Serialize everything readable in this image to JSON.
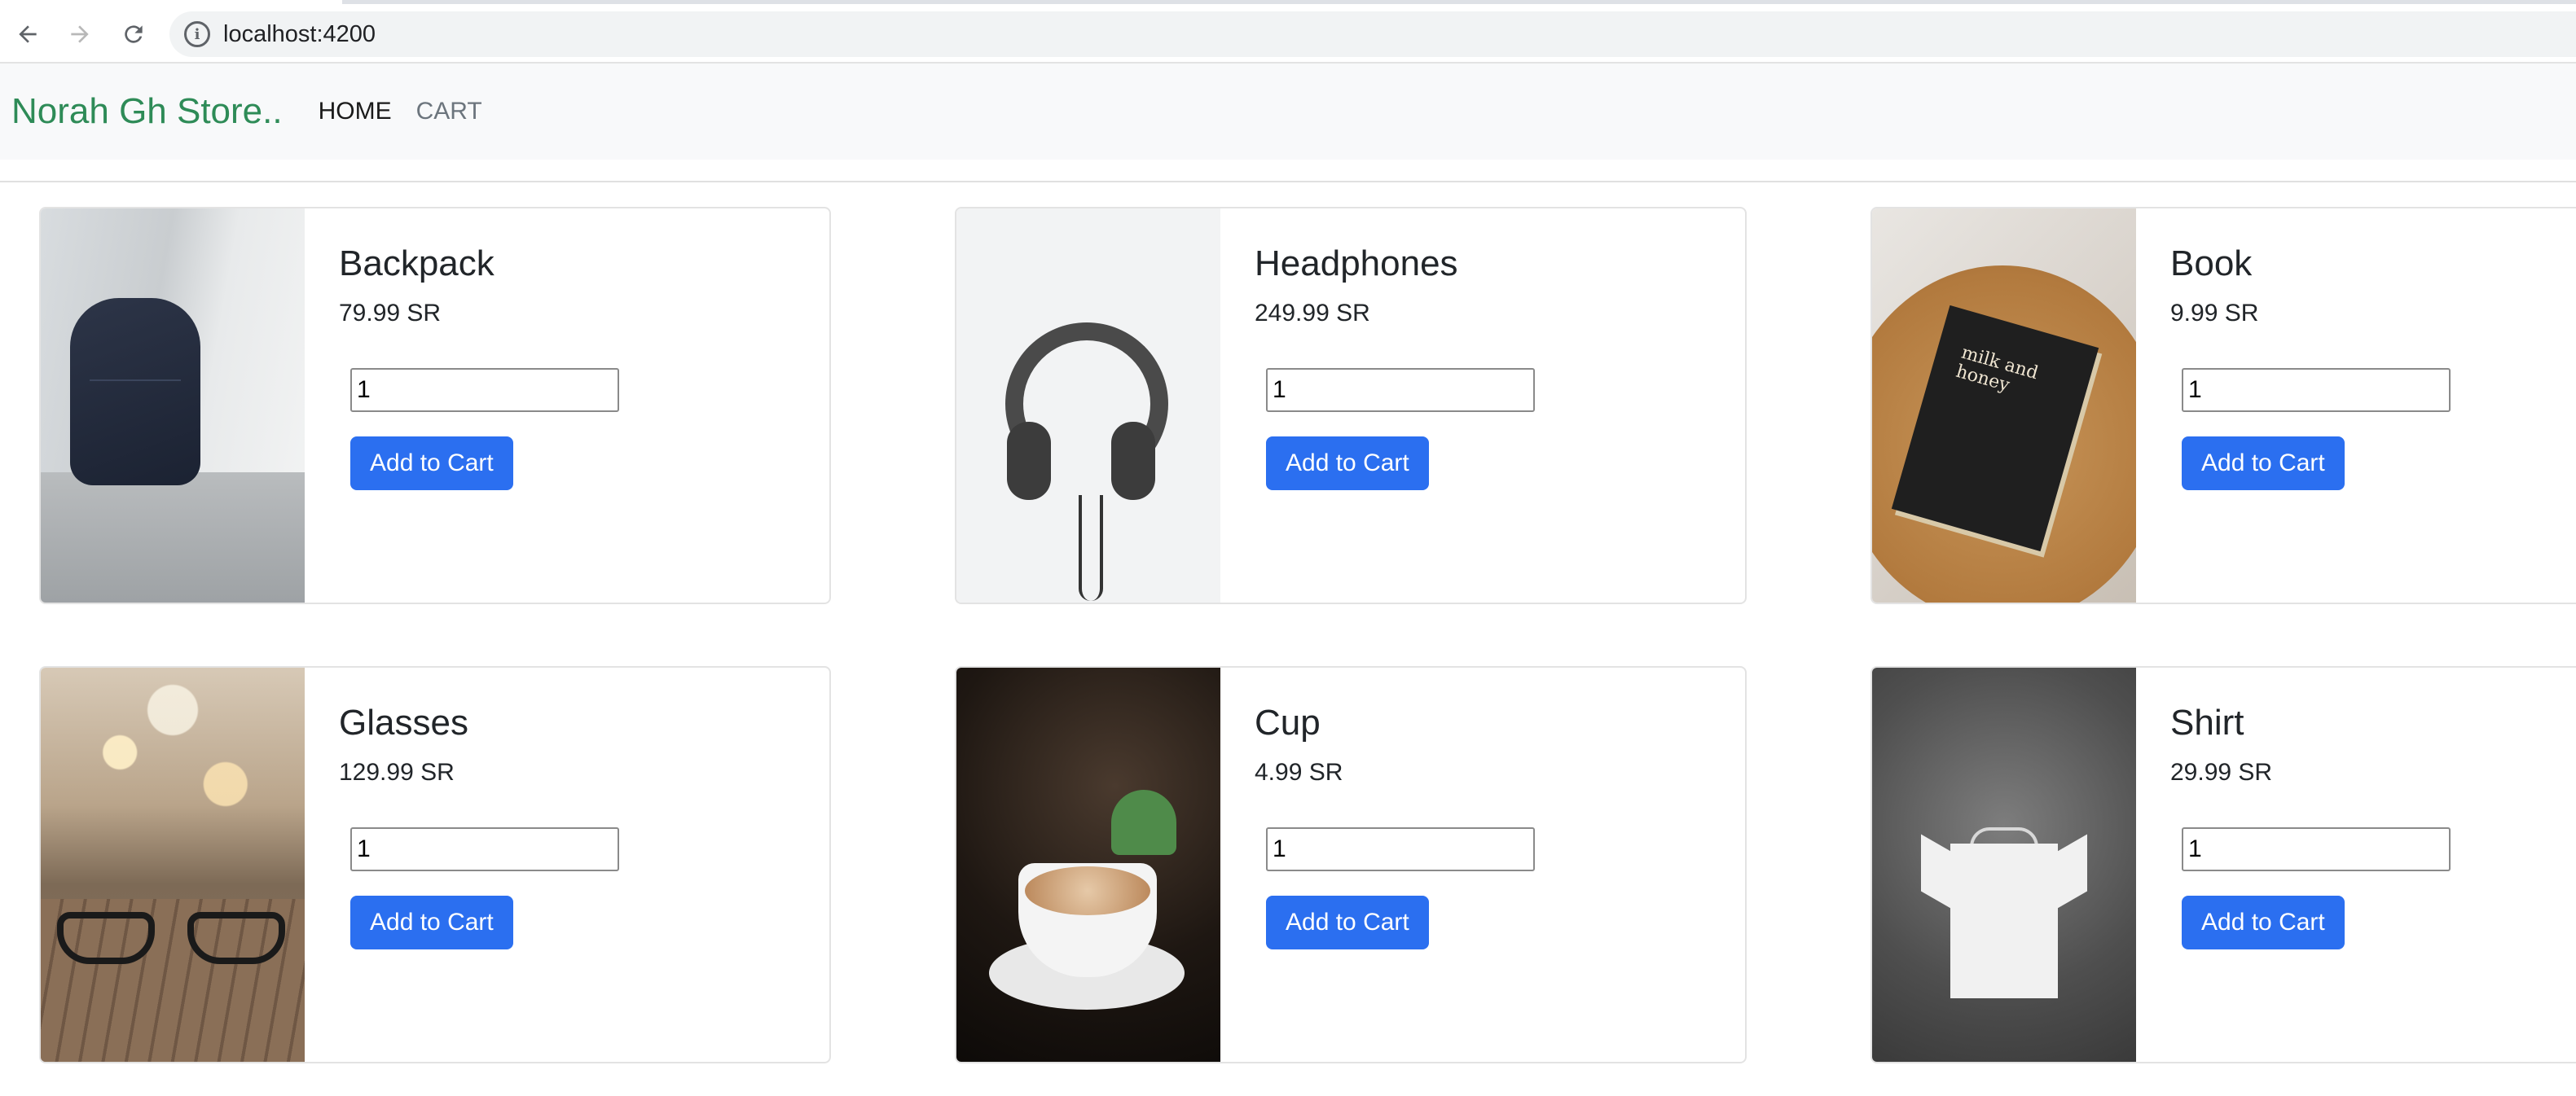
{
  "browser": {
    "url": "localhost:4200",
    "info_icon": "info-icon"
  },
  "navbar": {
    "brand": "Norah Gh Store..",
    "links": [
      {
        "label": "HOME",
        "active": true
      },
      {
        "label": "CART",
        "active": false
      }
    ]
  },
  "products": [
    {
      "name": "Backpack",
      "price": "79.99 SR",
      "quantity": "1",
      "button": "Add to Cart"
    },
    {
      "name": "Headphones",
      "price": "249.99 SR",
      "quantity": "1",
      "button": "Add to Cart"
    },
    {
      "name": "Book",
      "price": "9.99 SR",
      "quantity": "1",
      "button": "Add to Cart",
      "cover_text": "milk and honey"
    },
    {
      "name": "Glasses",
      "price": "129.99 SR",
      "quantity": "1",
      "button": "Add to Cart"
    },
    {
      "name": "Cup",
      "price": "4.99 SR",
      "quantity": "1",
      "button": "Add to Cart"
    },
    {
      "name": "Shirt",
      "price": "29.99 SR",
      "quantity": "1",
      "button": "Add to Cart"
    }
  ],
  "colors": {
    "brand": "#2e8b57",
    "button": "#2b6ff0",
    "navbar_bg": "#f8f9fa"
  }
}
